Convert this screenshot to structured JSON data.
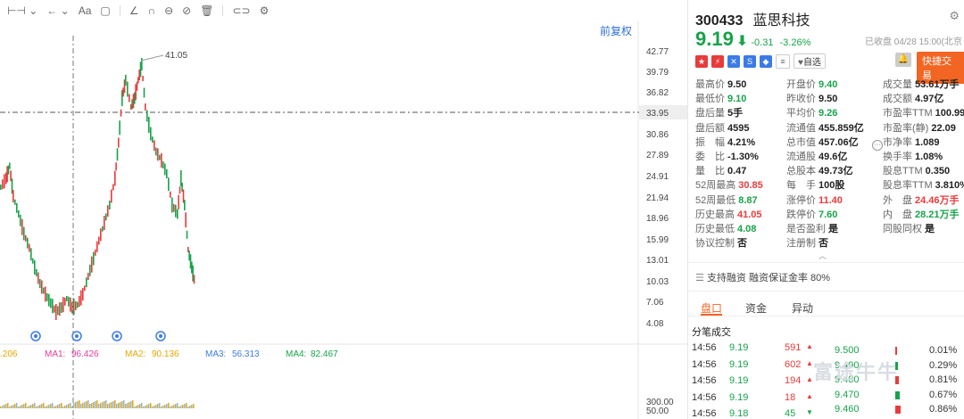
{
  "chart": {
    "restore_label": "前复权",
    "price_axis": [
      "42.77",
      "39.79",
      "36.82",
      "33.95",
      "30.86",
      "27.89",
      "24.91",
      "21.94",
      "18.96",
      "15.99",
      "13.01",
      "10.03",
      "7.06",
      "4.08"
    ],
    "crosshair_price": "33.95",
    "high_marker": "41.05",
    "volume_axis": [
      "300.00",
      "50.00"
    ],
    "ma_row": [
      {
        "label": ".206",
        "color": "#e6a700"
      },
      {
        "label": "MA1:",
        "color": "#e83b9b"
      },
      {
        "label": "96.426",
        "color": "#e83b9b"
      },
      {
        "label": "MA2:",
        "color": "#e6a700"
      },
      {
        "label": "90.136",
        "color": "#e6a700"
      },
      {
        "label": "MA3:",
        "color": "#3b7be8"
      },
      {
        "label": "56.313",
        "color": "#3b7be8"
      },
      {
        "label": "MA4:",
        "color": "#17a34a"
      },
      {
        "label": "82.467",
        "color": "#17a34a"
      }
    ]
  },
  "stock": {
    "code": "300433",
    "name": "蓝思科技",
    "price": "9.19",
    "change": "-0.31",
    "change_pct": "-3.26%",
    "status": "已收盘 04/28 15:00(北京",
    "watch_label": "自选",
    "trade_label": "快捷交易"
  },
  "stats_col1": [
    {
      "label": "最高价",
      "value": "9.50",
      "tone": "normal"
    },
    {
      "label": "最低价",
      "value": "9.10",
      "tone": "down"
    },
    {
      "label": "盘后量",
      "value": "5手",
      "tone": "normal"
    },
    {
      "label": "盘后额",
      "value": "4595",
      "tone": "normal"
    },
    {
      "label": "振　幅",
      "value": "4.21%",
      "tone": "normal"
    },
    {
      "label": "委　比",
      "value": "-1.30%",
      "tone": "normal"
    },
    {
      "label": "量　比",
      "value": "0.47",
      "tone": "normal"
    },
    {
      "label": "52周最高",
      "value": "30.85",
      "tone": "up"
    },
    {
      "label": "52周最低",
      "value": "8.87",
      "tone": "down"
    },
    {
      "label": "历史最高",
      "value": "41.05",
      "tone": "up"
    },
    {
      "label": "历史最低",
      "value": "4.08",
      "tone": "down"
    },
    {
      "label": "协议控制",
      "value": "否",
      "tone": "normal"
    }
  ],
  "stats_col2": [
    {
      "label": "开盘价",
      "value": "9.40",
      "tone": "down"
    },
    {
      "label": "昨收价",
      "value": "9.50",
      "tone": "normal"
    },
    {
      "label": "平均价",
      "value": "9.26",
      "tone": "down"
    },
    {
      "label": "流通值",
      "value": "455.859亿",
      "tone": "normal"
    },
    {
      "label": "总市值",
      "value": "457.06亿",
      "tone": "normal"
    },
    {
      "label": "流通股",
      "value": "49.6亿",
      "tone": "normal"
    },
    {
      "label": "总股本",
      "value": "49.73亿",
      "tone": "normal"
    },
    {
      "label": "每　手",
      "value": "100股",
      "tone": "normal"
    },
    {
      "label": "涨停价",
      "value": "11.40",
      "tone": "up"
    },
    {
      "label": "跌停价",
      "value": "7.60",
      "tone": "down"
    },
    {
      "label": "是否盈利",
      "value": "是",
      "tone": "normal"
    },
    {
      "label": "注册制",
      "value": "否",
      "tone": "normal"
    }
  ],
  "stats_col3": [
    {
      "label": "成交量",
      "value": "53.61万手",
      "tone": "normal"
    },
    {
      "label": "成交额",
      "value": "4.97亿",
      "tone": "normal"
    },
    {
      "label": "市盈率TTM",
      "value": "100.99",
      "tone": "normal"
    },
    {
      "label": "市盈率(静)",
      "value": "22.09",
      "tone": "normal"
    },
    {
      "label": "市净率",
      "value": "1.089",
      "tone": "normal"
    },
    {
      "label": "换手率",
      "value": "1.08%",
      "tone": "normal"
    },
    {
      "label": "股息TTM",
      "value": "0.350",
      "tone": "normal"
    },
    {
      "label": "股息率TTM",
      "value": "3.810%",
      "tone": "normal"
    },
    {
      "label": "外　盘",
      "value": "24.46万手",
      "tone": "up"
    },
    {
      "label": "内　盘",
      "value": "28.21万手",
      "tone": "down"
    },
    {
      "label": "同股同权",
      "value": "是",
      "tone": "normal"
    }
  ],
  "margin_text": "支持融资 融资保证金率 80%",
  "tabs": [
    "盘口",
    "资金",
    "异动"
  ],
  "trades_title": "分笔成交",
  "trades": [
    {
      "time": "14:56",
      "price": "9.19",
      "vol": "591",
      "dir": "up"
    },
    {
      "time": "14:56",
      "price": "9.19",
      "vol": "602",
      "dir": "up"
    },
    {
      "time": "14:56",
      "price": "9.19",
      "vol": "194",
      "dir": "up"
    },
    {
      "time": "14:56",
      "price": "9.19",
      "vol": "18",
      "dir": "up"
    },
    {
      "time": "14:56",
      "price": "9.18",
      "vol": "45",
      "dir": "down"
    }
  ],
  "depth": [
    {
      "price": "9.500",
      "pct": "0.01%"
    },
    {
      "price": "9.490",
      "pct": "0.29%"
    },
    {
      "price": "9.480",
      "pct": "0.81%"
    },
    {
      "price": "9.470",
      "pct": "0.67%"
    },
    {
      "price": "9.460",
      "pct": "0.86%"
    }
  ],
  "watermark": "富途牛牛"
}
